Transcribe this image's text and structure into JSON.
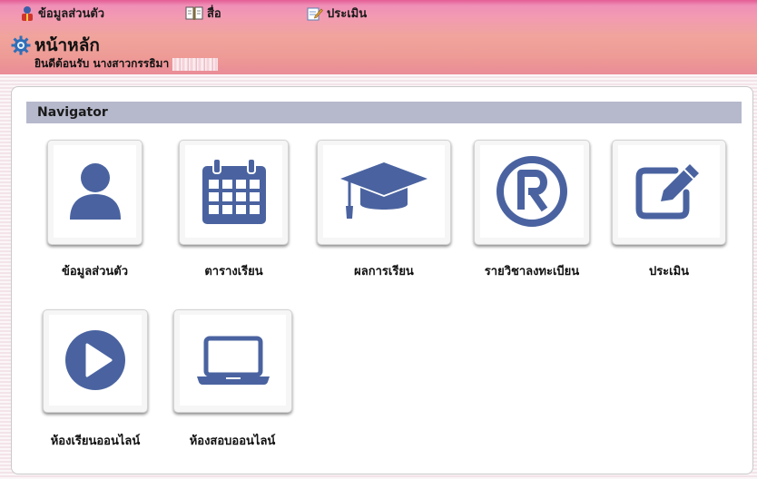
{
  "top_menu": {
    "items": [
      {
        "label": "ข้อมูลส่วนตัว",
        "icon": "user-gift-icon"
      },
      {
        "label": "สื่อ",
        "icon": "book-icon"
      },
      {
        "label": "ประเมิน",
        "icon": "edit-icon"
      }
    ]
  },
  "header": {
    "title": "หน้าหลัก",
    "welcome": "ยินดีต้อนรับ นางสาวกรรธิมา"
  },
  "navigator": {
    "heading": "Navigator",
    "tiles": [
      {
        "label": "ข้อมูลส่วนตัว",
        "icon": "user-icon"
      },
      {
        "label": "ตารางเรียน",
        "icon": "calendar-icon"
      },
      {
        "label": "ผลการเรียน",
        "icon": "graduation-cap-icon"
      },
      {
        "label": "รายวิชาลงทะเบียน",
        "icon": "registered-icon"
      },
      {
        "label": "ประเมิน",
        "icon": "edit-icon"
      },
      {
        "label": "ห้องเรียนออนไลน์",
        "icon": "play-icon"
      },
      {
        "label": "ห้องสอบออนไลน์",
        "icon": "laptop-icon"
      }
    ]
  },
  "colors": {
    "icon": "#4a63a0",
    "header_pink": "#ef9aa7",
    "nav_bar": "#b6b9cc"
  }
}
